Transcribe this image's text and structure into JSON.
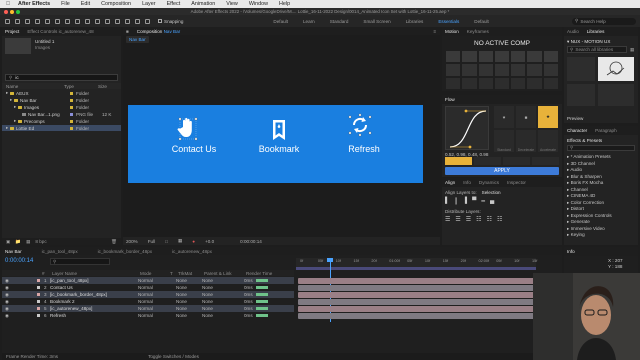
{
  "menubar": {
    "apple": "",
    "app_name": "After Effects",
    "items": [
      "File",
      "Edit",
      "Composition",
      "Layer",
      "Effect",
      "Animation",
      "View",
      "Window",
      "Help"
    ]
  },
  "window_title": "Adobe After Effects 2022 - /Volumes/GoogleDrive/M.... Lottie_16-11-2022 Design/0014_Animated Icon Set with Lottie_16-11-25.aep *",
  "toolbar": {
    "snapping": "Snapping",
    "workspaces": [
      "Default",
      "Learn",
      "Standard",
      "Small Screen",
      "Libraries",
      "Essentials",
      "Default"
    ],
    "active_workspace": "Essentials",
    "search_help": "Search Help"
  },
  "project": {
    "tabs": [
      "Project",
      "Effect Controls ic_autorenew_48"
    ],
    "item_name": "Untitled 1",
    "item_sub": "Images",
    "search_value": "ic",
    "columns": [
      "Name",
      "Type",
      "Size"
    ],
    "rows": [
      {
        "name": "AEUX",
        "type": "Folder",
        "size": "",
        "indent": 0,
        "kind": "folder"
      },
      {
        "name": "Nav Bar",
        "type": "Folder",
        "size": "",
        "indent": 1,
        "kind": "folder"
      },
      {
        "name": "Images",
        "type": "Folder",
        "size": "",
        "indent": 2,
        "kind": "folder"
      },
      {
        "name": "Nav Bar...1.png",
        "type": "PNG file",
        "size": "12 K",
        "indent": 3,
        "kind": "file"
      },
      {
        "name": "Precomps",
        "type": "Folder",
        "size": "",
        "indent": 2,
        "kind": "folder"
      },
      {
        "name": "Lottie Ed",
        "type": "Folder",
        "size": "",
        "indent": 0,
        "kind": "folder",
        "selected": true
      }
    ],
    "footer_bpc": "8 bpc"
  },
  "composition": {
    "tab_label": "Composition",
    "tab_name": "Nav Bar",
    "tabs": [
      "ic_pan_tool_48px",
      "ic_bookmark_border_48px",
      "ic_autorenew_48px"
    ],
    "crumb": "Nav Bar",
    "nav_items": [
      {
        "label": "Contact Us",
        "icon": "hand-icon"
      },
      {
        "label": "Bookmark",
        "icon": "bookmark-icon"
      },
      {
        "label": "Refresh",
        "icon": "refresh-icon"
      }
    ],
    "bg_color": "#1a7fe0",
    "footer": {
      "zoom": "200%",
      "quality": "Full",
      "exposure": "+0.0",
      "time": "0:00:00:14"
    }
  },
  "motion": {
    "tabs": [
      "Motion",
      "Keyframes"
    ],
    "message": "NO ACTIVE COMP"
  },
  "flow": {
    "tab": "Flow",
    "value": "0.52, 0.98, 0.48, 0.98",
    "apply": "APPLY",
    "preset_labels": [
      "Standard",
      "Decelerate",
      "Accelerate"
    ]
  },
  "align": {
    "tabs": [
      "Align",
      "Info",
      "Dynamics",
      "Inspector"
    ],
    "align_to_label": "Align Layers to:",
    "align_to_value": "Selection",
    "distribute_label": "Distribute Layers:"
  },
  "libraries": {
    "tabs": [
      "Audio",
      "Libraries"
    ],
    "library": "NUX - MOTION UX",
    "search_placeholder": "Search all libraries",
    "preview": "Preview"
  },
  "effects": {
    "tabs": [
      "Character",
      "Paragraph"
    ],
    "panel_title": "Effects & Presets",
    "items": [
      "* Animation Presets",
      "3D Channel",
      "Audio",
      "Blur & Sharpen",
      "Boris FX Mocha",
      "Channel",
      "CINEMA 4D",
      "Color Correction",
      "Distort",
      "Expression Controls",
      "Generate",
      "Immersive Video",
      "Keying"
    ]
  },
  "timeline": {
    "tabs": [
      "Nav Bar",
      "ic_pan_tool_48px",
      "ic_bookmark_border_48px",
      "ic_autorenew_48px"
    ],
    "timecode": "0:00:00:14",
    "columns": [
      "#",
      "Layer Name",
      "Mode",
      "T",
      "TrkMat",
      "Parent & Link",
      "Render Time"
    ],
    "layers": [
      {
        "num": "1",
        "name": "[ic_pan_tool_48px]",
        "mode": "Normal",
        "trkmat": "None",
        "parent": "None",
        "render": "0ms",
        "color": "#d9a6a6",
        "selected": true
      },
      {
        "num": "2",
        "name": "Contact Us",
        "mode": "Normal",
        "trkmat": "None",
        "parent": "None",
        "render": "0ms",
        "color": "#c8c8c8",
        "selected": false
      },
      {
        "num": "3",
        "name": "[ic_bookmark_border_48px]",
        "mode": "Normal",
        "trkmat": "None",
        "parent": "None",
        "render": "0ms",
        "color": "#d9a6a6",
        "selected": true
      },
      {
        "num": "4",
        "name": "Bookmark 2",
        "mode": "Normal",
        "trkmat": "None",
        "parent": "None",
        "render": "0ms",
        "color": "#c8c8c8",
        "selected": false
      },
      {
        "num": "5",
        "name": "[ic_autorenew_48px]",
        "mode": "Normal",
        "trkmat": "None",
        "parent": "None",
        "render": "0ms",
        "color": "#d9a6a6",
        "selected": true
      },
      {
        "num": "6",
        "name": "Refresh",
        "mode": "Normal",
        "trkmat": "None",
        "parent": "None",
        "render": "0ms",
        "color": "#c8c8c8",
        "selected": false
      }
    ],
    "ruler_ticks": [
      "0f",
      "05f",
      "10f",
      "15f",
      "20f",
      "01:00f",
      "05f",
      "10f",
      "15f",
      "20f",
      "02:00f",
      "05f",
      "10f",
      "15f"
    ],
    "footer_render": "Frame Render Time: 3ms",
    "footer_toggle": "Toggle Switches / Modes"
  },
  "info": {
    "tab": "Info",
    "x": "X : 207",
    "y": "Y : 188"
  }
}
